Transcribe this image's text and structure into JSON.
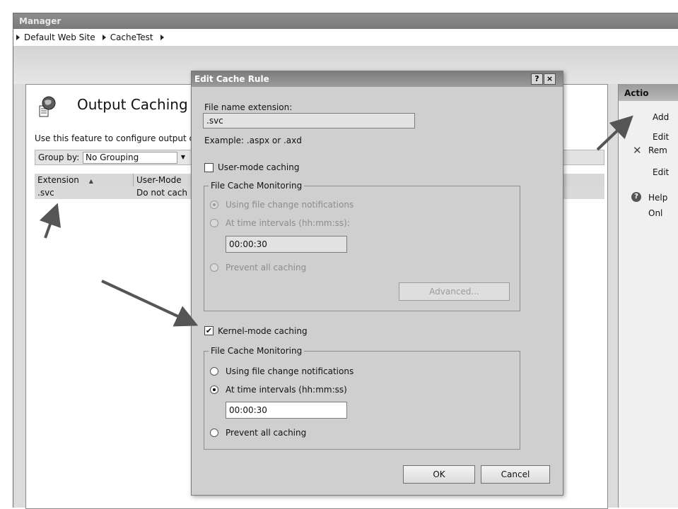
{
  "window": {
    "title": "Manager"
  },
  "breadcrumb": [
    "Default Web Site",
    "CacheTest"
  ],
  "feature": {
    "title": "Output Caching",
    "description": "Use this feature to configure output c",
    "group_by_label": "Group by:",
    "group_by_value": "No Grouping",
    "table": {
      "columns": [
        "Extension",
        "User-Mode"
      ],
      "rows": [
        {
          "extension": ".svc",
          "user_mode": "Do not cach"
        }
      ]
    }
  },
  "actions": {
    "header": "Actio",
    "items": [
      "Add",
      "Edit",
      "Rem",
      "Edit",
      "Help",
      "Onl"
    ]
  },
  "dialog": {
    "title": "Edit Cache Rule",
    "help_btn": "?",
    "close_btn": "×",
    "extension_label": "File name extension:",
    "extension_value": ".svc",
    "example_text": "Example: .aspx or .axd",
    "user_mode": {
      "label": "User-mode caching",
      "checked": false,
      "group_label": "File Cache Monitoring",
      "opt_notifications": "Using file change notifications",
      "opt_intervals": "At time intervals (hh:mm:ss):",
      "interval_value": "00:00:30",
      "opt_prevent": "Prevent all caching",
      "advanced_btn": "Advanced..."
    },
    "kernel_mode": {
      "label": "Kernel-mode caching",
      "checked": true,
      "check_mark": "✔",
      "group_label": "File Cache Monitoring",
      "opt_notifications": "Using file change notifications",
      "opt_intervals": "At time intervals (hh:mm:ss)",
      "interval_value": "00:00:30",
      "opt_prevent": "Prevent all caching"
    },
    "ok_btn": "OK",
    "cancel_btn": "Cancel"
  },
  "icons": {
    "dropdown": "▼",
    "sort": "▲",
    "remove": "✕",
    "help": "?"
  }
}
